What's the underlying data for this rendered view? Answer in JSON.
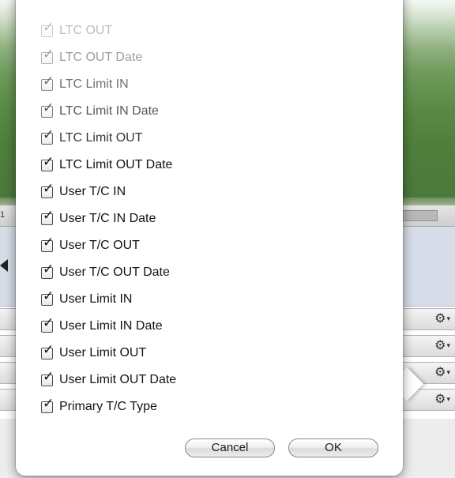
{
  "background": {
    "timeline_marker": "1",
    "gear_rows": [
      {
        "icon": "gear-icon"
      },
      {
        "icon": "gear-icon"
      },
      {
        "icon": "gear-icon"
      },
      {
        "icon": "gear-icon"
      }
    ]
  },
  "popover": {
    "items": [
      {
        "label": "LTC OUT",
        "checked": true
      },
      {
        "label": "LTC OUT Date",
        "checked": true
      },
      {
        "label": "LTC Limit IN",
        "checked": true
      },
      {
        "label": "LTC Limit IN Date",
        "checked": true
      },
      {
        "label": "LTC Limit OUT",
        "checked": true
      },
      {
        "label": "LTC Limit OUT Date",
        "checked": true
      },
      {
        "label": "User T/C IN",
        "checked": true
      },
      {
        "label": "User T/C IN Date",
        "checked": true
      },
      {
        "label": "User T/C OUT",
        "checked": true
      },
      {
        "label": "User T/C OUT Date",
        "checked": true
      },
      {
        "label": "User Limit IN",
        "checked": true
      },
      {
        "label": "User Limit IN Date",
        "checked": true
      },
      {
        "label": "User Limit OUT",
        "checked": true
      },
      {
        "label": "User Limit OUT Date",
        "checked": true
      },
      {
        "label": "Primary T/C Type",
        "checked": true
      }
    ],
    "cancel_label": "Cancel",
    "ok_label": "OK"
  },
  "colors": {
    "video_green": "#5a8b45",
    "panel_blue": "#d6dde8"
  }
}
